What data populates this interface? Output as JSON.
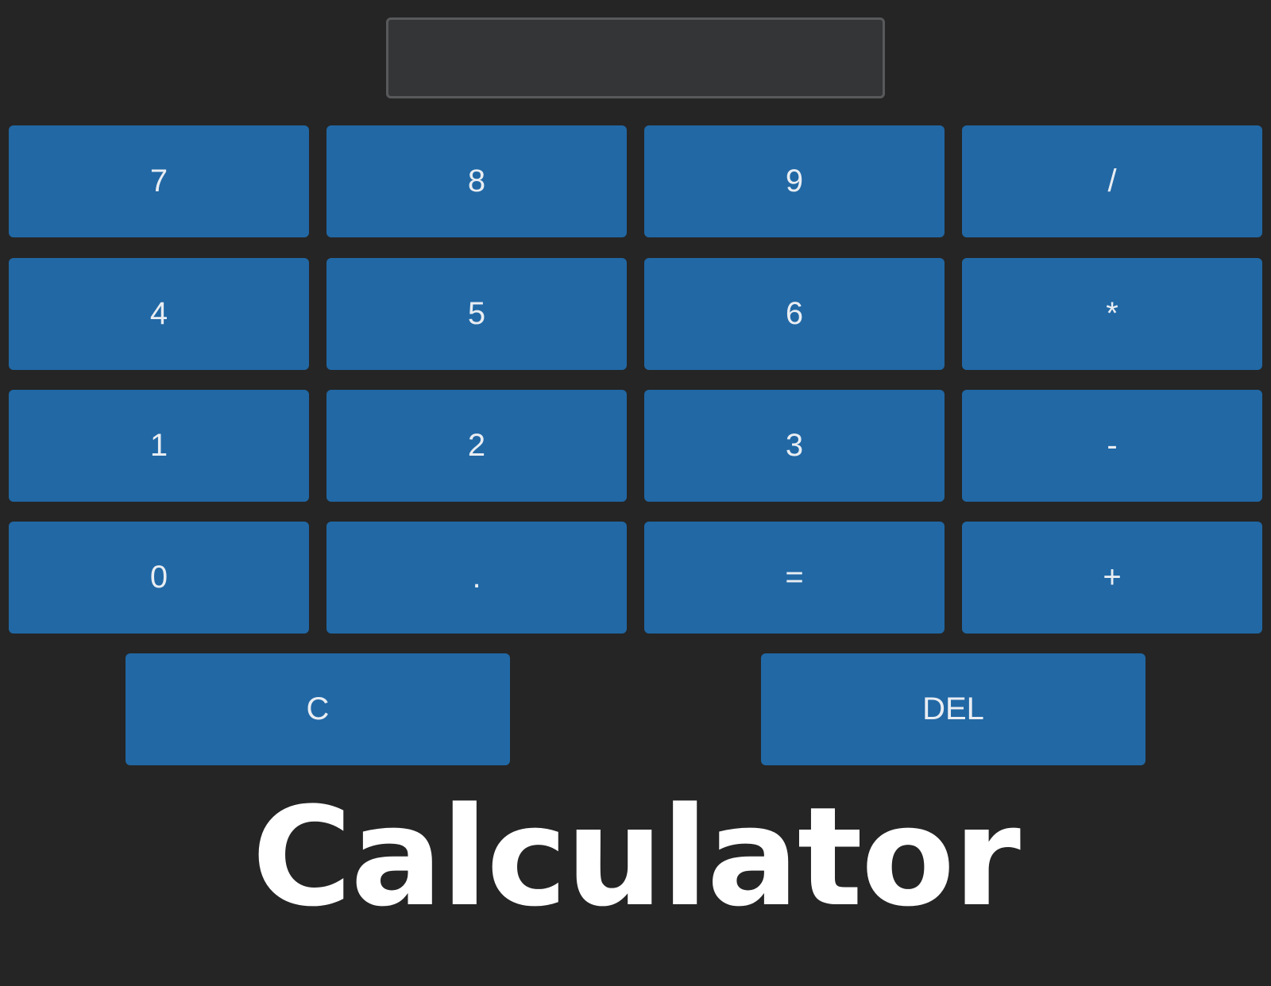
{
  "display": {
    "value": ""
  },
  "keypad": {
    "k7": "7",
    "k8": "8",
    "k9": "9",
    "divide": "/",
    "k4": "4",
    "k5": "5",
    "k6": "6",
    "multiply": "*",
    "k1": "1",
    "k2": "2",
    "k3": "3",
    "subtract": "-",
    "k0": "0",
    "decimal": ".",
    "equals": "=",
    "add": "+",
    "clear": "C",
    "delete": "DEL"
  },
  "title": "Calculator",
  "colors": {
    "background": "#252525",
    "display_bg": "#343537",
    "display_border": "#58595b",
    "button_bg": "#2168a5",
    "button_text": "#e9edf2",
    "title_text": "#ffffff"
  }
}
